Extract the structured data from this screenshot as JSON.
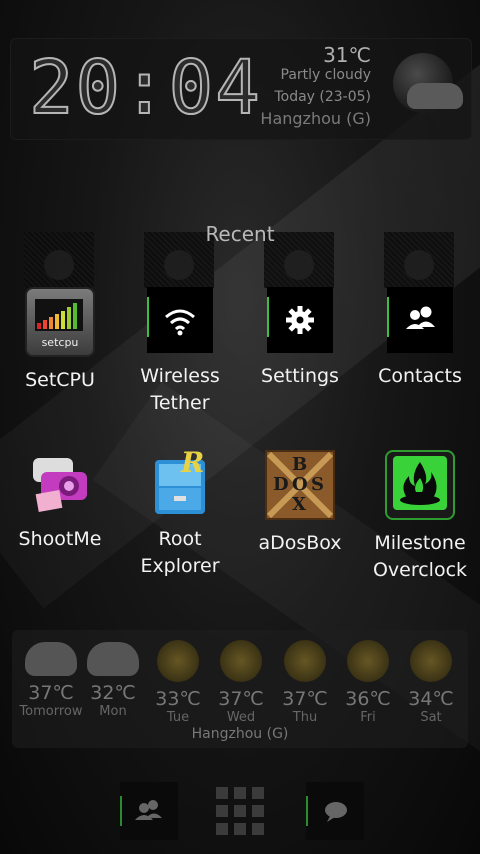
{
  "clock": {
    "time": "20:04",
    "temp": "31℃",
    "condition": "Partly cloudy",
    "date": "Today  (23-05)",
    "city": "Hangzhou (G)"
  },
  "recent": {
    "title": "Recent",
    "apps": [
      {
        "label": "SetCPU",
        "icon": "setcpu-icon"
      },
      {
        "label": "Wireless\nTether",
        "icon": "wifi-icon"
      },
      {
        "label": "Settings",
        "icon": "gear-icon"
      },
      {
        "label": "Contacts",
        "icon": "contacts-icon"
      }
    ],
    "setcpu_badge": "setcpu"
  },
  "apps_row2": [
    {
      "label": "ShootMe",
      "icon": "camera-icon"
    },
    {
      "label": "Root Explorer",
      "icon": "file-cabinet-icon"
    },
    {
      "label": "aDosBox",
      "icon": "dosbox-icon"
    },
    {
      "label": "Milestone\nOverclock",
      "icon": "flame-icon"
    }
  ],
  "dosbox_letters": [
    "B",
    "O",
    "D",
    "S",
    "X"
  ],
  "root_letter": "R",
  "forecast": {
    "city": "Hangzhou (G)",
    "days": [
      {
        "name": "Tomorrow",
        "temp": "37℃",
        "icon": "rain-cloud-icon"
      },
      {
        "name": "Mon",
        "temp": "32℃",
        "icon": "rain-cloud-icon"
      },
      {
        "name": "Tue",
        "temp": "33℃",
        "icon": "sun-cloud-icon"
      },
      {
        "name": "Wed",
        "temp": "37℃",
        "icon": "sun-icon"
      },
      {
        "name": "Thu",
        "temp": "37℃",
        "icon": "sun-icon"
      },
      {
        "name": "Fri",
        "temp": "36℃",
        "icon": "sun-icon"
      },
      {
        "name": "Sat",
        "temp": "34℃",
        "icon": "sun-icon"
      }
    ]
  },
  "colors": {
    "accent_green": "#3fbf3f"
  }
}
